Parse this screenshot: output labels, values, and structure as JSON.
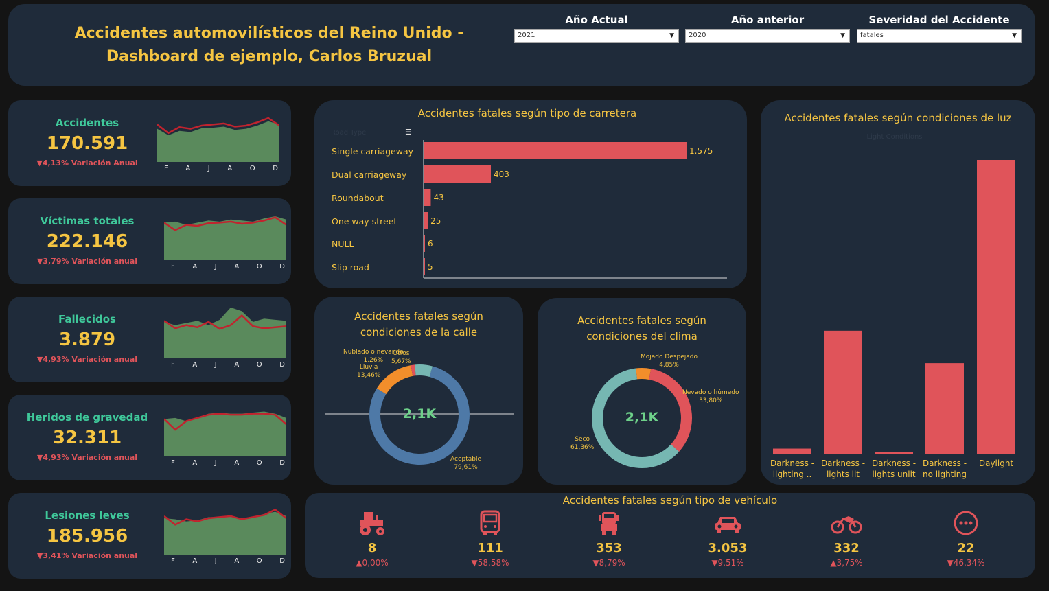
{
  "header": {
    "title": "Accidentes automovilísticos del Reino Unido - Dashboard de ejemplo, Carlos Bruzual",
    "filters": [
      {
        "label": "Año Actual",
        "value": "2021"
      },
      {
        "label": "Año anterior",
        "value": "2020"
      },
      {
        "label": "Severidad del Accidente",
        "value": "fatales"
      }
    ]
  },
  "months": [
    "F",
    "A",
    "J",
    "A",
    "O",
    "D"
  ],
  "kpis": [
    {
      "label": "Accidentes",
      "value": "170.591",
      "variation": "▼4,13% Variación Anual",
      "area": [
        0.62,
        0.5,
        0.58,
        0.56,
        0.63,
        0.64,
        0.66,
        0.6,
        0.62,
        0.68,
        0.76,
        0.7
      ],
      "line": [
        0.7,
        0.54,
        0.65,
        0.62,
        0.68,
        0.7,
        0.72,
        0.66,
        0.68,
        0.74,
        0.82,
        0.68
      ]
    },
    {
      "label": "Víctimas totales",
      "value": "222.146",
      "variation": "▼3,79% Variación anual",
      "area": [
        0.7,
        0.72,
        0.66,
        0.7,
        0.74,
        0.72,
        0.76,
        0.74,
        0.72,
        0.78,
        0.82,
        0.76
      ],
      "line": [
        0.7,
        0.56,
        0.66,
        0.64,
        0.69,
        0.7,
        0.72,
        0.68,
        0.7,
        0.74,
        0.8,
        0.66
      ]
    },
    {
      "label": "Fallecidos",
      "value": "3.879",
      "variation": "▼4,93% Variación anual",
      "area": [
        0.68,
        0.62,
        0.66,
        0.7,
        0.62,
        0.72,
        0.95,
        0.88,
        0.68,
        0.74,
        0.72,
        0.7
      ],
      "line": [
        0.7,
        0.56,
        0.62,
        0.58,
        0.68,
        0.55,
        0.62,
        0.8,
        0.6,
        0.56,
        0.58,
        0.6
      ]
    },
    {
      "label": "Heridos de gravedad",
      "value": "32.311",
      "variation": "▼4,93% Variación anual",
      "area": [
        0.7,
        0.72,
        0.66,
        0.72,
        0.8,
        0.82,
        0.8,
        0.8,
        0.82,
        0.84,
        0.8,
        0.72
      ],
      "line": [
        0.7,
        0.5,
        0.66,
        0.72,
        0.78,
        0.8,
        0.78,
        0.78,
        0.8,
        0.8,
        0.78,
        0.6
      ]
    },
    {
      "label": "Lesiones leves",
      "value": "185.956",
      "variation": "▼3,41% Variación anual",
      "area": [
        0.68,
        0.66,
        0.62,
        0.64,
        0.7,
        0.7,
        0.72,
        0.68,
        0.7,
        0.76,
        0.8,
        0.72
      ],
      "line": [
        0.72,
        0.56,
        0.66,
        0.62,
        0.68,
        0.7,
        0.72,
        0.66,
        0.7,
        0.74,
        0.84,
        0.68
      ]
    }
  ],
  "road": {
    "title": "Accidentes fatales según tipo de carretera",
    "axis_header": "Road Type",
    "chart_data": {
      "type": "bar",
      "orientation": "horizontal",
      "categories": [
        "Single carriageway",
        "Dual carriageway",
        "Roundabout",
        "One way street",
        "NULL",
        "Slip road"
      ],
      "values": [
        1575,
        403,
        43,
        25,
        6,
        5
      ],
      "labels": [
        "1.575",
        "403",
        "43",
        "25",
        "6",
        "5"
      ],
      "color": "#e0545a"
    }
  },
  "street": {
    "title": "Accidentes fatales según condiciones de la calle",
    "center": "2,1K",
    "chart_data": {
      "type": "pie",
      "slices": [
        {
          "name": "Aceptable",
          "value": 79.61,
          "label": "79,61%",
          "color": "#4e79a7"
        },
        {
          "name": "Lluvia",
          "value": 13.46,
          "label": "13,46%",
          "color": "#f28e2b"
        },
        {
          "name": "Nublado o nevando",
          "value": 1.26,
          "label": "1,26%",
          "color": "#e0545a"
        },
        {
          "name": "Otros",
          "value": 5.67,
          "label": "5,67%",
          "color": "#76b7b2"
        }
      ]
    }
  },
  "weather": {
    "title": "Accidentes fatales según condiciones del clima",
    "center": "2,1K",
    "chart_data": {
      "type": "pie",
      "slices": [
        {
          "name": "Mojado Despejado",
          "value": 4.85,
          "label": "4,85%",
          "color": "#f28e2b"
        },
        {
          "name": "Nevado o húmedo",
          "value": 33.8,
          "label": "33,80%",
          "color": "#e0545a"
        },
        {
          "name": "Seco",
          "value": 61.36,
          "label": "61,36%",
          "color": "#76b7b2"
        }
      ]
    }
  },
  "light": {
    "title": "Accidentes fatales según condiciones de luz",
    "axis_header": "Light Conditions",
    "chart_data": {
      "type": "bar",
      "categories": [
        "Darkness - lighting ..",
        "Darkness - lights lit",
        "Darkness - lights unlit",
        "Darkness - no lighting",
        "Daylight"
      ],
      "values": [
        15,
        360,
        5,
        265,
        860
      ],
      "color": "#e0545a"
    }
  },
  "vehicles": {
    "title": "Accidentes fatales según tipo de vehículo",
    "items": [
      {
        "icon": "tractor-icon",
        "count": "8",
        "variation": "▲0,00%"
      },
      {
        "icon": "bus-icon",
        "count": "111",
        "variation": "▼58,58%"
      },
      {
        "icon": "truck-icon",
        "count": "353",
        "variation": "▼8,79%"
      },
      {
        "icon": "car-icon",
        "count": "3.053",
        "variation": "▼9,51%"
      },
      {
        "icon": "motorcycle-icon",
        "count": "332",
        "variation": "▲3,75%"
      },
      {
        "icon": "more-icon",
        "count": "22",
        "variation": "▼46,34%"
      }
    ]
  },
  "colors": {
    "accent": "#f5c542",
    "green": "#3fc89a",
    "red": "#e0545a",
    "panel": "#1f2b3a"
  }
}
